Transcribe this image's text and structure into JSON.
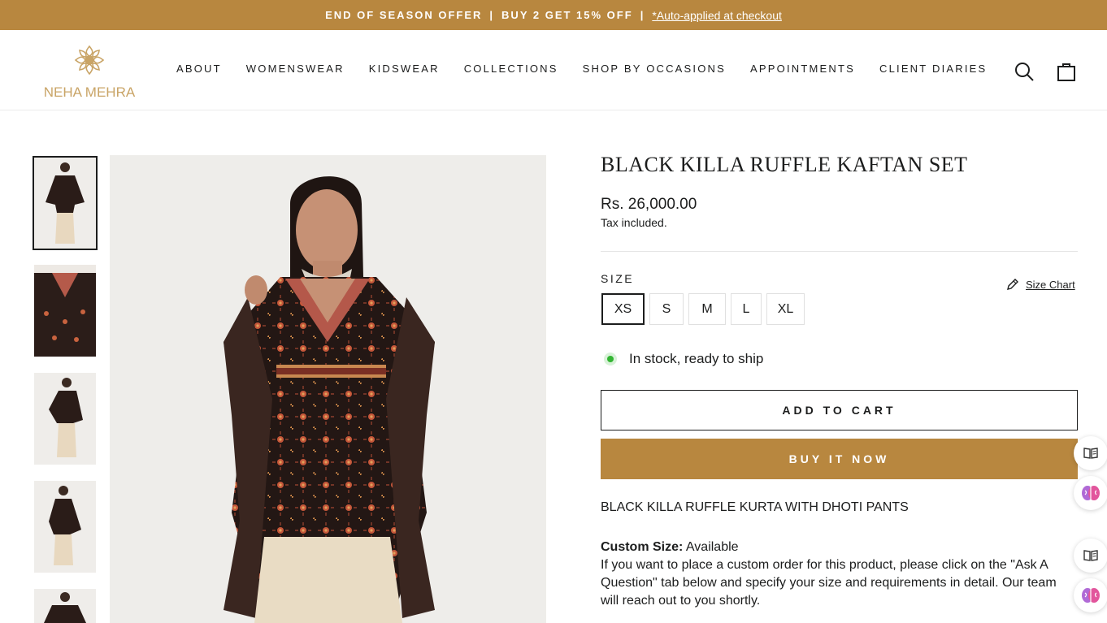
{
  "announcement": {
    "part1": "END OF SEASON OFFER",
    "part2": "BUY 2 GET 15% OFF",
    "separator": "|",
    "link": "*Auto-applied at checkout"
  },
  "brand": {
    "name": "NEHA MEHRA",
    "accent_color": "#b8873f",
    "logo_color": "#c9a466"
  },
  "nav": {
    "items": [
      "ABOUT",
      "WOMENSWEAR",
      "KIDSWEAR",
      "COLLECTIONS",
      "SHOP BY OCCASIONS",
      "APPOINTMENTS",
      "CLIENT DIARIES"
    ]
  },
  "header_icons": [
    "search-icon",
    "cart-bag-icon"
  ],
  "product": {
    "title": "BLACK KILLA RUFFLE KAFTAN SET",
    "price": "Rs. 26,000.00",
    "tax_note": "Tax included.",
    "size_label": "SIZE",
    "size_chart": "Size Chart",
    "sizes": [
      "XS",
      "S",
      "M",
      "L",
      "XL"
    ],
    "selected_size": "XS",
    "stock": "In stock, ready to ship",
    "add_to_cart": "ADD TO CART",
    "buy_now": "BUY IT NOW",
    "subtitle": "BLACK KILLA RUFFLE KURTA WITH DHOTI PANTS",
    "custom_label": "Custom Size:",
    "custom_value": "Available",
    "custom_text": "If you want to place a custom order for this product, please click on the \"Ask A Question\" tab below and specify your size and requirements in detail. Our team will reach out to you shortly."
  },
  "gallery": {
    "thumbnail_count": 5,
    "active_index": 0
  },
  "widgets": [
    "book-icon",
    "brain-icon",
    "book-icon",
    "brain-icon"
  ]
}
